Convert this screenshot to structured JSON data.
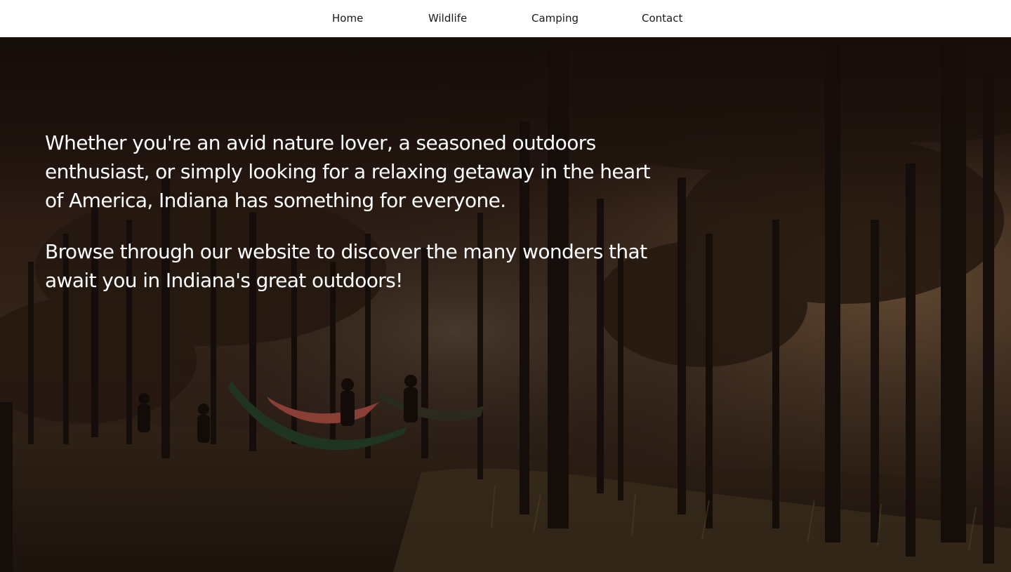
{
  "nav": {
    "items": [
      {
        "label": "Home"
      },
      {
        "label": "Wildlife"
      },
      {
        "label": "Camping"
      },
      {
        "label": "Contact"
      }
    ]
  },
  "hero": {
    "paragraph1": "Whether you're an avid nature lover, a seasoned outdoors enthusiast, or simply looking for a relaxing getaway in the heart of America, Indiana has something for everyone.",
    "paragraph2": "Browse through our website to discover the many wonders that await you in Indiana's great outdoors!"
  },
  "colors": {
    "nav_background": "#ffffff",
    "nav_text": "#1a1a1a",
    "hero_text": "#ffffff",
    "hero_overlay": "#1d1410"
  }
}
